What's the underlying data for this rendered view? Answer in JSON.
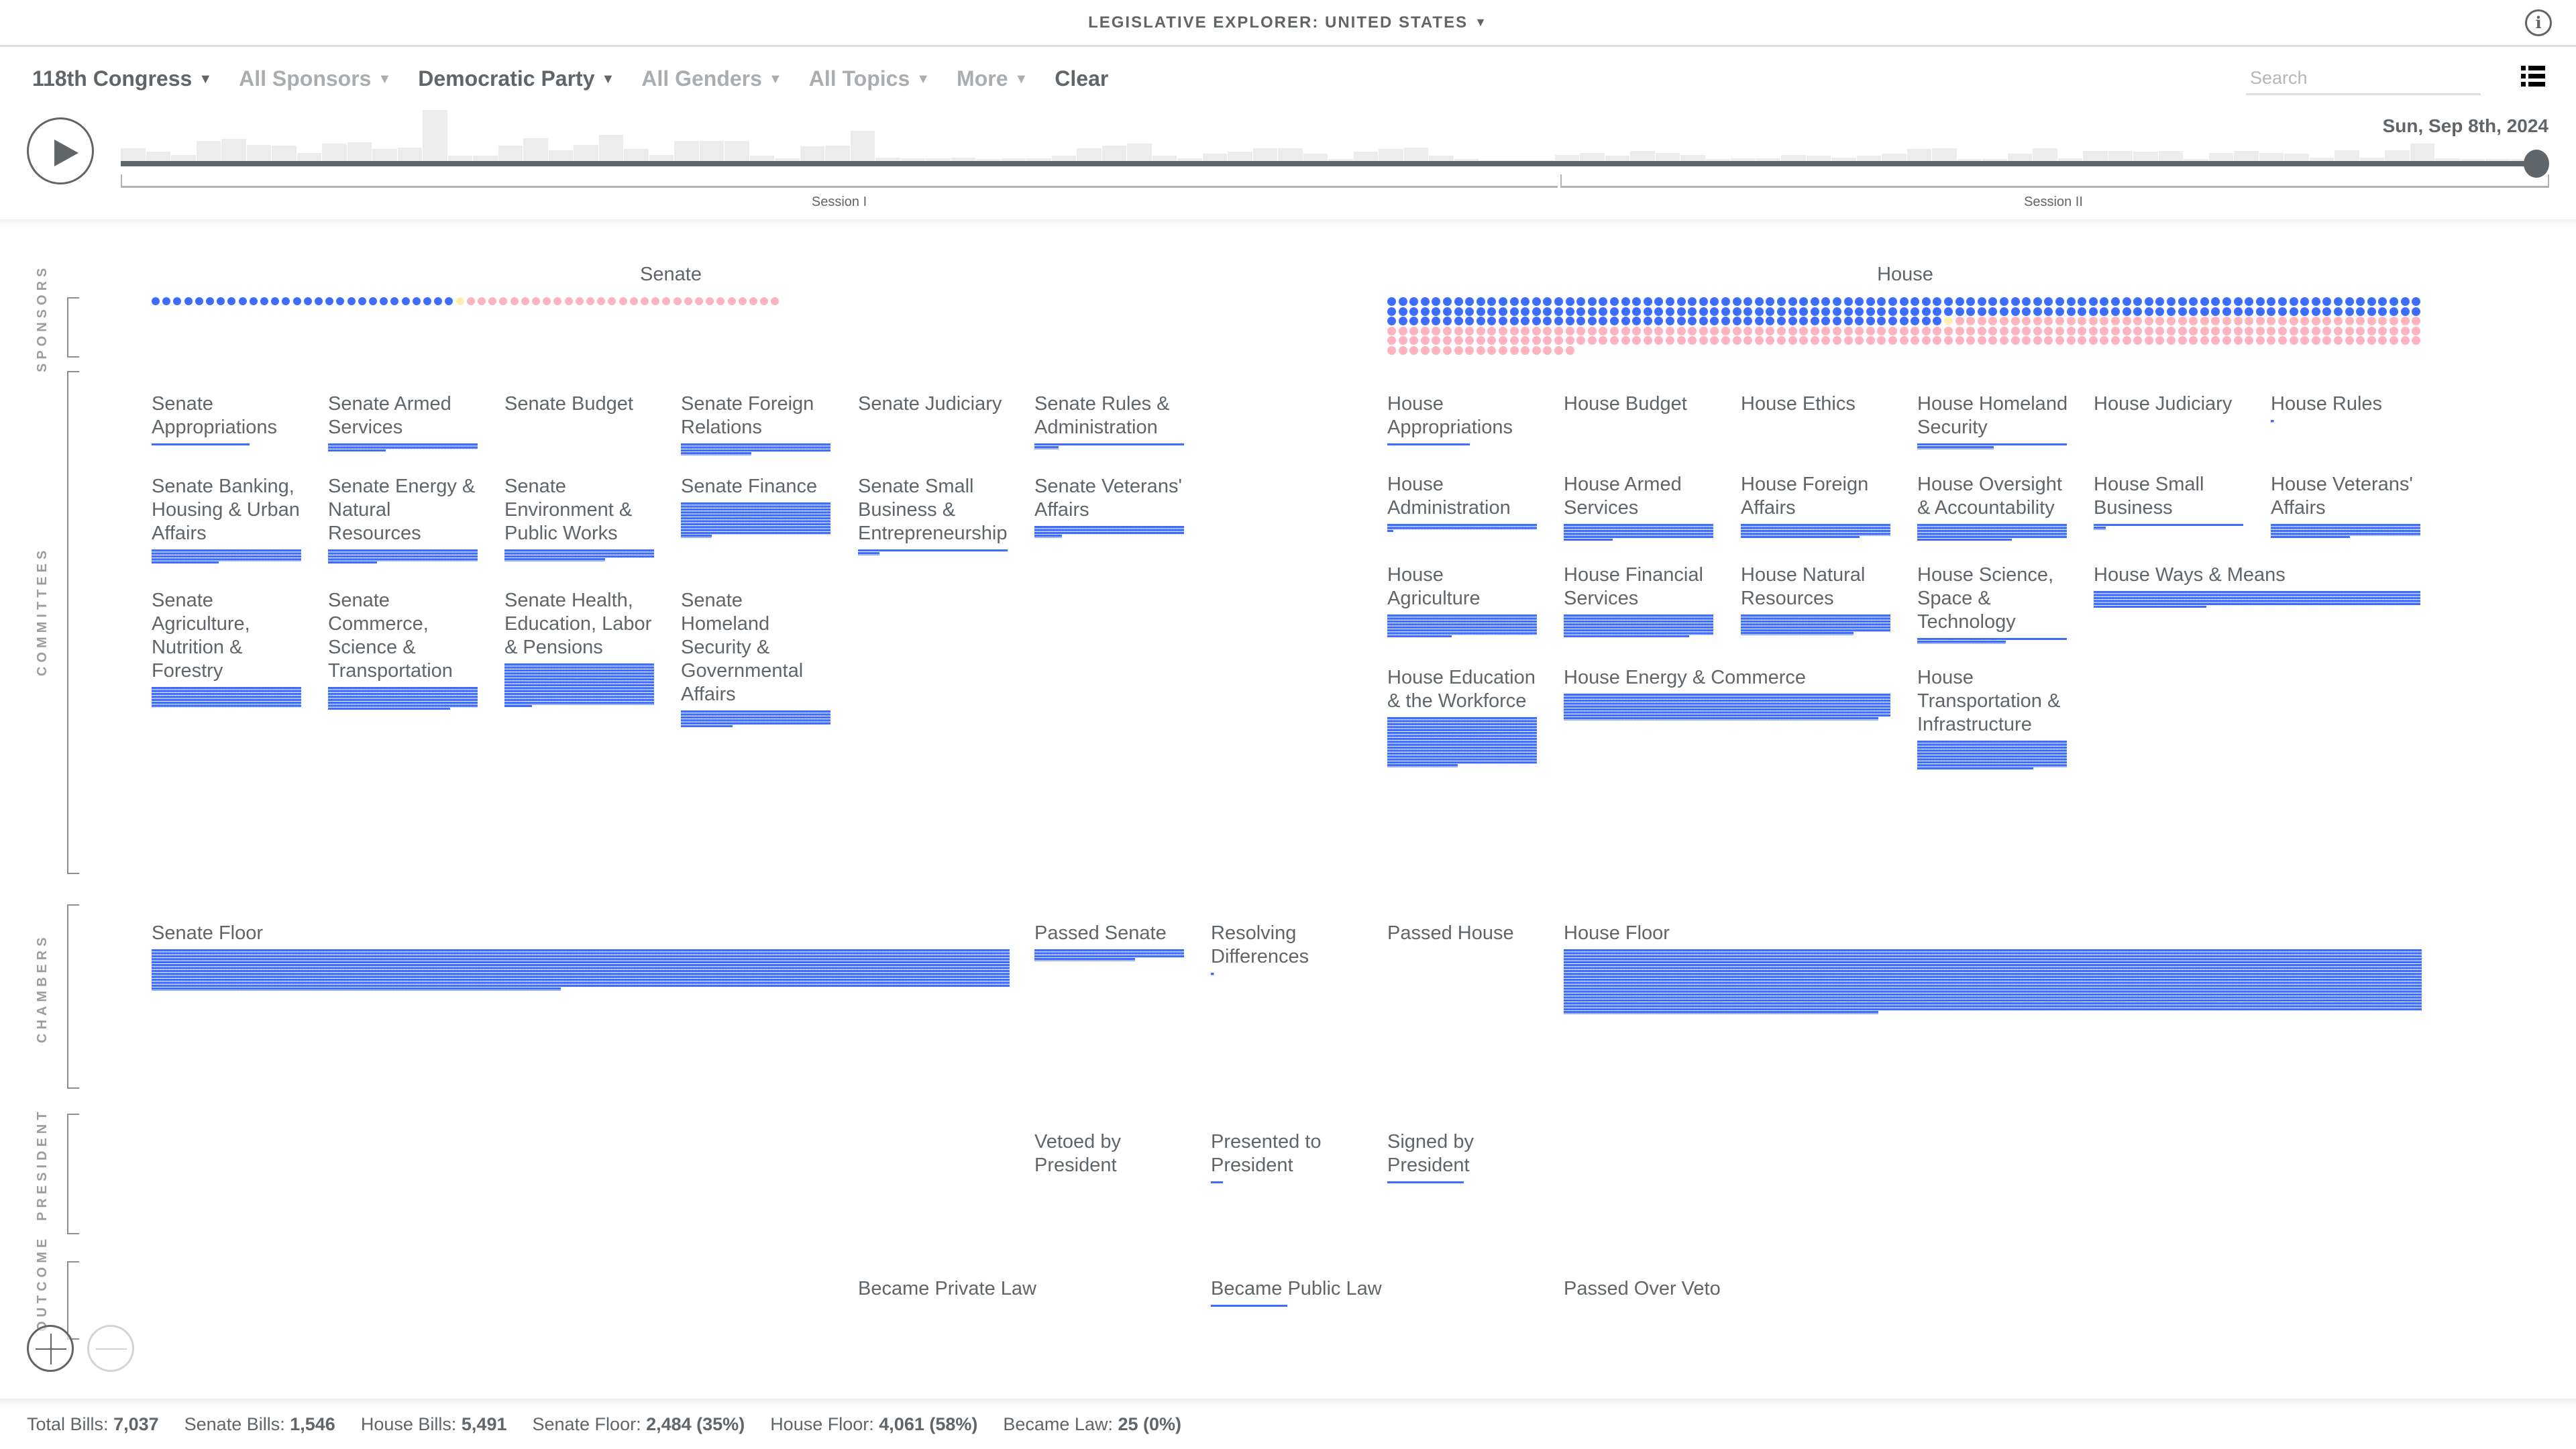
{
  "header": {
    "title": "LEGISLATIVE EXPLORER: UNITED STATES",
    "info_icon": "info-icon"
  },
  "filters": [
    {
      "label": "118th Congress",
      "active": true
    },
    {
      "label": "All Sponsors",
      "active": false
    },
    {
      "label": "Democratic Party",
      "active": true
    },
    {
      "label": "All Genders",
      "active": false
    },
    {
      "label": "All Topics",
      "active": false
    },
    {
      "label": "More",
      "active": false
    }
  ],
  "clear_label": "Clear",
  "search": {
    "placeholder": "Search",
    "value": ""
  },
  "timeline": {
    "current_date": "Sun, Sep 8th, 2024",
    "progress": 1.0,
    "sessions": [
      "Session I",
      "Session II"
    ],
    "histogram": [
      14,
      10,
      7,
      22,
      24,
      18,
      17,
      9,
      19,
      21,
      13,
      15,
      56,
      6,
      6,
      17,
      25,
      12,
      18,
      29,
      13,
      7,
      22,
      22,
      22,
      6,
      3,
      16,
      17,
      33,
      4,
      3,
      3,
      4,
      2,
      3,
      3,
      6,
      14,
      17,
      19,
      6,
      3,
      8,
      10,
      14,
      14,
      8,
      2,
      10,
      13,
      15,
      6,
      2,
      1,
      1,
      1,
      7,
      9,
      6,
      11,
      9,
      7,
      2,
      3,
      3,
      7,
      6,
      4,
      6,
      8,
      13,
      14,
      2,
      2,
      8,
      14,
      3,
      11,
      11,
      10,
      11,
      2,
      9,
      11,
      9,
      8,
      4,
      12,
      4,
      12,
      19,
      3,
      2,
      2,
      2
    ],
    "session_split": 0.595
  },
  "axis_labels": [
    "SPONSORS",
    "COMMITTEES",
    "CHAMBERS",
    "PRESIDENT",
    "OUTCOME"
  ],
  "colors": {
    "democrat": "#3d6cff",
    "republican": "#ffb3bf",
    "independent": "#ffedb3",
    "bill": "#3d6cff",
    "text": "#5f6569"
  },
  "sponsors": {
    "senate": {
      "title": "Senate",
      "democrat": 28,
      "independent": 1,
      "republican": 29
    },
    "house": {
      "title": "House",
      "democrat": 236,
      "independent": 1,
      "republican": 245
    }
  },
  "committees": {
    "senate": [
      {
        "label": "Senate\nAppropriations",
        "full_rows": 0,
        "partial": 32
      },
      {
        "label": "Senate Armed\nServices",
        "full_rows": 2,
        "partial": 19
      },
      {
        "label": "Senate Budget",
        "full_rows": 0,
        "partial": 0
      },
      {
        "label": "Senate Foreign\nRelations",
        "full_rows": 3,
        "partial": 23
      },
      {
        "label": "Senate Judiciary",
        "full_rows": 0,
        "partial": 0
      },
      {
        "label": "Senate Rules &\nAdministration",
        "full_rows": 1,
        "partial": 8
      },
      {
        "label": "Senate Banking,\nHousing & Urban\nAffairs",
        "full_rows": 4,
        "partial": 22
      },
      {
        "label": "Senate Energy &\nNatural\nResources",
        "full_rows": 4,
        "partial": 16
      },
      {
        "label": "Senate\nEnvironment &\nPublic Works",
        "full_rows": 3,
        "partial": 33
      },
      {
        "label": "Senate Finance",
        "full_rows": 11,
        "partial": 10
      },
      {
        "label": "Senate Small\nBusiness &\nEntrepreneurship",
        "full_rows": 1,
        "partial": 7
      },
      {
        "label": "Senate Veterans'\nAffairs",
        "full_rows": 3,
        "partial": 9
      },
      {
        "label": "Senate\nAgriculture,\nNutrition &\nForestry",
        "full_rows": 7,
        "partial": 0
      },
      {
        "label": "Senate\nCommerce,\nScience &\nTransportation",
        "full_rows": 7,
        "partial": 40
      },
      {
        "label": "Senate Health,\nEducation, Labor\n& Pensions",
        "full_rows": 14,
        "partial": 9
      },
      {
        "label": "Senate\nHomeland\nSecurity &\nGovernmental\nAffairs",
        "full_rows": 5,
        "partial": 17
      }
    ],
    "house": [
      {
        "label": "House\nAppropriations",
        "full_rows": 0,
        "partial": 27
      },
      {
        "label": "House Budget",
        "full_rows": 0,
        "partial": 0
      },
      {
        "label": "House Ethics",
        "full_rows": 0,
        "partial": 0
      },
      {
        "label": "House Homeland\nSecurity",
        "full_rows": 1,
        "partial": 25
      },
      {
        "label": "House Judiciary",
        "full_rows": 0,
        "partial": 0
      },
      {
        "label": "House Rules",
        "full_rows": 0,
        "partial": 1
      },
      {
        "label": "House\nAdministration",
        "full_rows": 2,
        "partial": 2
      },
      {
        "label": "House Armed\nServices",
        "full_rows": 5,
        "partial": 16
      },
      {
        "label": "House Foreign\nAffairs",
        "full_rows": 4,
        "partial": 39
      },
      {
        "label": "House Oversight\n& Accountability",
        "full_rows": 5,
        "partial": 31
      },
      {
        "label": "House Small\nBusiness",
        "full_rows": 1,
        "partial": 4
      },
      {
        "label": "House Veterans'\nAffairs",
        "full_rows": 4,
        "partial": 26
      },
      {
        "label": "House\nAgriculture",
        "full_rows": 7,
        "partial": 21
      },
      {
        "label": "House Financial\nServices",
        "full_rows": 7,
        "partial": 41
      },
      {
        "label": "House Natural\nResources",
        "full_rows": 6,
        "partial": 37
      },
      {
        "label": "House Science,\nSpace &\nTechnology",
        "full_rows": 1,
        "partial": 29
      },
      {
        "label": "House Ways & Means",
        "full_rows": 5,
        "partial": 37,
        "span": 2
      },
      {
        "label": "House Education\n& the Workforce",
        "full_rows": 16,
        "partial": 23
      },
      {
        "label": "House Energy & Commerce",
        "full_rows": 8,
        "partial": 103,
        "span": 2
      },
      {
        "label": "House\nTransportation &\nInfrastructure",
        "full_rows": 9,
        "partial": 38
      }
    ]
  },
  "chambers": [
    {
      "label": "Senate Floor",
      "full_rows": 13,
      "partial": 134,
      "span": 5
    },
    {
      "label": "Passed Senate",
      "full_rows": 3,
      "partial": 33
    },
    {
      "label": "Resolving\nDifferences",
      "full_rows": 0,
      "partial": 1
    },
    {
      "label": "Passed House",
      "full_rows": 0,
      "partial": 0
    },
    {
      "label": "House Floor",
      "full_rows": 21,
      "partial": 103,
      "span": 5
    }
  ],
  "president": [
    {
      "label": "Vetoed by\nPresident",
      "full_rows": 0,
      "partial": 0
    },
    {
      "label": "Presented to\nPresident",
      "full_rows": 0,
      "partial": 4
    },
    {
      "label": "Signed by\nPresident",
      "full_rows": 0,
      "partial": 25
    }
  ],
  "outcome": [
    {
      "label": "Became Private Law",
      "full_rows": 0,
      "partial": 0
    },
    {
      "label": "Became Public Law",
      "full_rows": 0,
      "partial": 25
    },
    {
      "label": "Passed Over Veto",
      "full_rows": 0,
      "partial": 0
    }
  ],
  "footer": [
    {
      "label": "Total Bills:",
      "value": "7,037"
    },
    {
      "label": "Senate Bills:",
      "value": "1,546"
    },
    {
      "label": "House Bills:",
      "value": "5,491"
    },
    {
      "label": "Senate Floor:",
      "value": "2,484 (35%)"
    },
    {
      "label": "House Floor:",
      "value": "4,061 (58%)"
    },
    {
      "label": "Became Law:",
      "value": "25 (0%)"
    }
  ]
}
